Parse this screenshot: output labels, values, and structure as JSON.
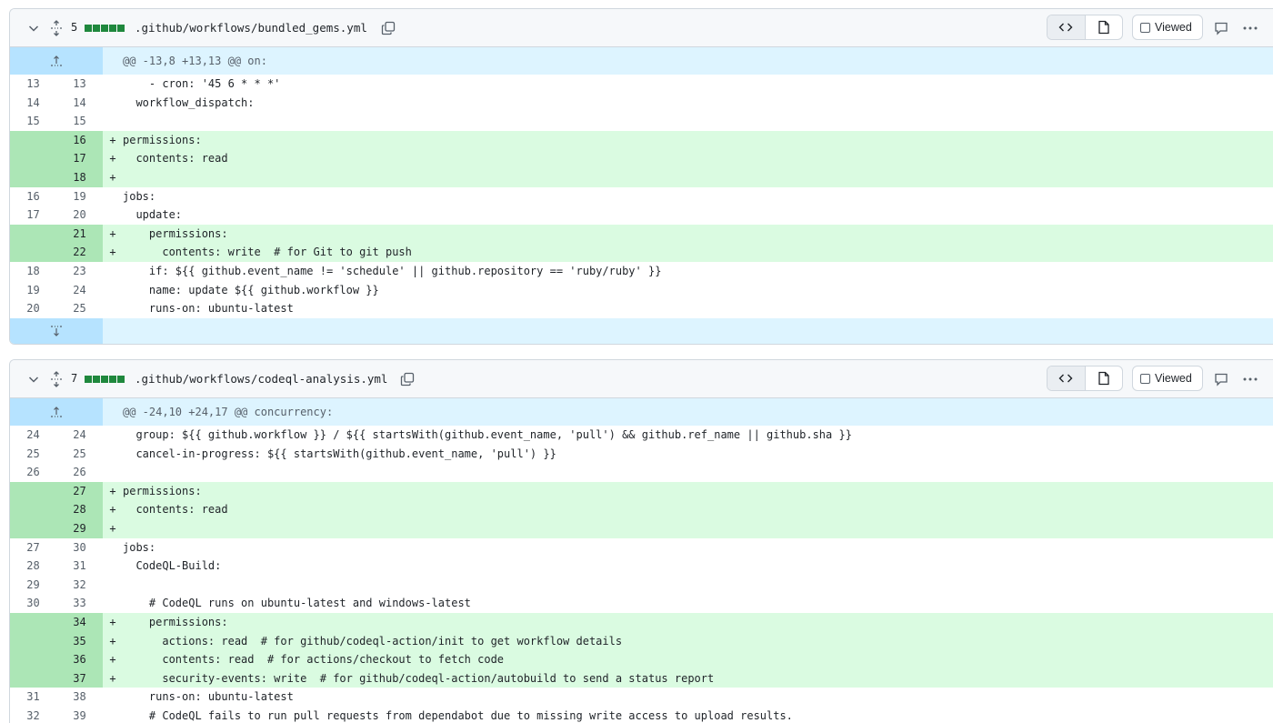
{
  "files": [
    {
      "changes": "5",
      "name": ".github/workflows/bundled_gems.yml",
      "viewed_label": "Viewed",
      "hunk_header": "@@ -13,8 +13,13 @@ on:",
      "lines": [
        {
          "old": "13",
          "new": "13",
          "type": "ctx",
          "mark": "",
          "code": "    - cron: '45 6 * * *'"
        },
        {
          "old": "14",
          "new": "14",
          "type": "ctx",
          "mark": "",
          "code": "  workflow_dispatch:"
        },
        {
          "old": "15",
          "new": "15",
          "type": "ctx",
          "mark": "",
          "code": ""
        },
        {
          "old": "",
          "new": "16",
          "type": "add",
          "mark": "+",
          "code": "permissions:"
        },
        {
          "old": "",
          "new": "17",
          "type": "add",
          "mark": "+",
          "code": "  contents: read"
        },
        {
          "old": "",
          "new": "18",
          "type": "add",
          "mark": "+",
          "code": ""
        },
        {
          "old": "16",
          "new": "19",
          "type": "ctx",
          "mark": "",
          "code": "jobs:"
        },
        {
          "old": "17",
          "new": "20",
          "type": "ctx",
          "mark": "",
          "code": "  update:"
        },
        {
          "old": "",
          "new": "21",
          "type": "add",
          "mark": "+",
          "code": "    permissions:"
        },
        {
          "old": "",
          "new": "22",
          "type": "add",
          "mark": "+",
          "code": "      contents: write  # for Git to git push"
        },
        {
          "old": "18",
          "new": "23",
          "type": "ctx",
          "mark": "",
          "code": "    if: ${{ github.event_name != 'schedule' || github.repository == 'ruby/ruby' }}"
        },
        {
          "old": "19",
          "new": "24",
          "type": "ctx",
          "mark": "",
          "code": "    name: update ${{ github.workflow }}"
        },
        {
          "old": "20",
          "new": "25",
          "type": "ctx",
          "mark": "",
          "code": "    runs-on: ubuntu-latest"
        }
      ]
    },
    {
      "changes": "7",
      "name": ".github/workflows/codeql-analysis.yml",
      "viewed_label": "Viewed",
      "hunk_header": "@@ -24,10 +24,17 @@ concurrency:",
      "lines": [
        {
          "old": "24",
          "new": "24",
          "type": "ctx",
          "mark": "",
          "code": "  group: ${{ github.workflow }} / ${{ startsWith(github.event_name, 'pull') && github.ref_name || github.sha }}"
        },
        {
          "old": "25",
          "new": "25",
          "type": "ctx",
          "mark": "",
          "code": "  cancel-in-progress: ${{ startsWith(github.event_name, 'pull') }}"
        },
        {
          "old": "26",
          "new": "26",
          "type": "ctx",
          "mark": "",
          "code": ""
        },
        {
          "old": "",
          "new": "27",
          "type": "add",
          "mark": "+",
          "code": "permissions:"
        },
        {
          "old": "",
          "new": "28",
          "type": "add",
          "mark": "+",
          "code": "  contents: read"
        },
        {
          "old": "",
          "new": "29",
          "type": "add",
          "mark": "+",
          "code": ""
        },
        {
          "old": "27",
          "new": "30",
          "type": "ctx",
          "mark": "",
          "code": "jobs:"
        },
        {
          "old": "28",
          "new": "31",
          "type": "ctx",
          "mark": "",
          "code": "  CodeQL-Build:"
        },
        {
          "old": "29",
          "new": "32",
          "type": "ctx",
          "mark": "",
          "code": ""
        },
        {
          "old": "30",
          "new": "33",
          "type": "ctx",
          "mark": "",
          "code": "    # CodeQL runs on ubuntu-latest and windows-latest"
        },
        {
          "old": "",
          "new": "34",
          "type": "add",
          "mark": "+",
          "code": "    permissions:"
        },
        {
          "old": "",
          "new": "35",
          "type": "add",
          "mark": "+",
          "code": "      actions: read  # for github/codeql-action/init to get workflow details"
        },
        {
          "old": "",
          "new": "36",
          "type": "add",
          "mark": "+",
          "code": "      contents: read  # for actions/checkout to fetch code"
        },
        {
          "old": "",
          "new": "37",
          "type": "add",
          "mark": "+",
          "code": "      security-events: write  # for github/codeql-action/autobuild to send a status report"
        },
        {
          "old": "31",
          "new": "38",
          "type": "ctx",
          "mark": "",
          "code": "    runs-on: ubuntu-latest"
        },
        {
          "old": "32",
          "new": "39",
          "type": "ctx",
          "mark": "",
          "code": "    # CodeQL fails to run pull requests from dependabot due to missing write access to upload results."
        }
      ]
    }
  ],
  "colors": {
    "added_gutter": "#ace6b6",
    "added_line": "#dafbe1",
    "hunk_bg": "#ddf4ff",
    "diffstat_green": "#1f883d"
  },
  "icons": [
    "chevron-down-icon",
    "unfold-icon",
    "copy-icon",
    "code-icon",
    "file-icon",
    "comment-icon",
    "kebab-icon",
    "expand-up-icon",
    "expand-down-icon"
  ]
}
